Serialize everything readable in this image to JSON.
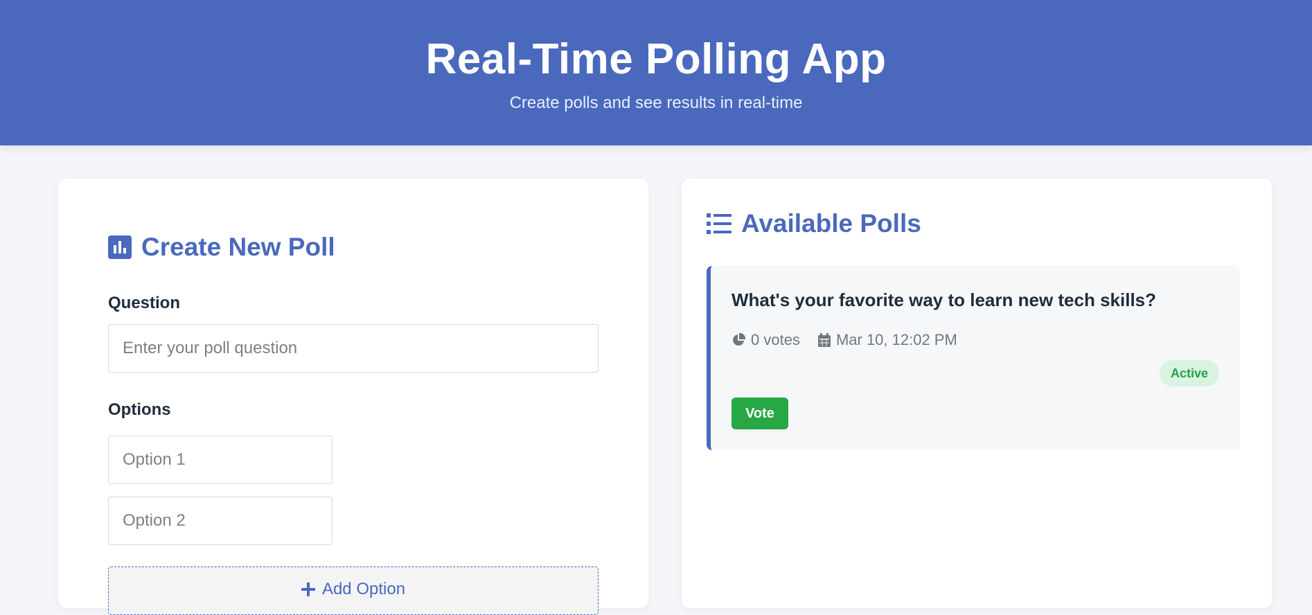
{
  "header": {
    "title": "Real-Time Polling App",
    "subtitle": "Create polls and see results in real-time"
  },
  "create_panel": {
    "title": "Create New Poll",
    "question_label": "Question",
    "question_placeholder": "Enter your poll question",
    "options_label": "Options",
    "option_placeholders": [
      "Option 1",
      "Option 2"
    ],
    "add_option_label": "Add Option"
  },
  "polls_panel": {
    "title": "Available Polls",
    "polls": [
      {
        "question": "What's your favorite way to learn new tech skills?",
        "votes": "0 votes",
        "date": "Mar 10, 12:02 PM",
        "status": "Active",
        "vote_label": "Vote"
      }
    ]
  },
  "colors": {
    "primary": "#4a69bd",
    "success": "#28a745",
    "background": "#f4f5f8"
  },
  "icons": [
    "poll-chart-icon",
    "list-icon",
    "pie-chart-icon",
    "calendar-icon",
    "plus-icon"
  ]
}
